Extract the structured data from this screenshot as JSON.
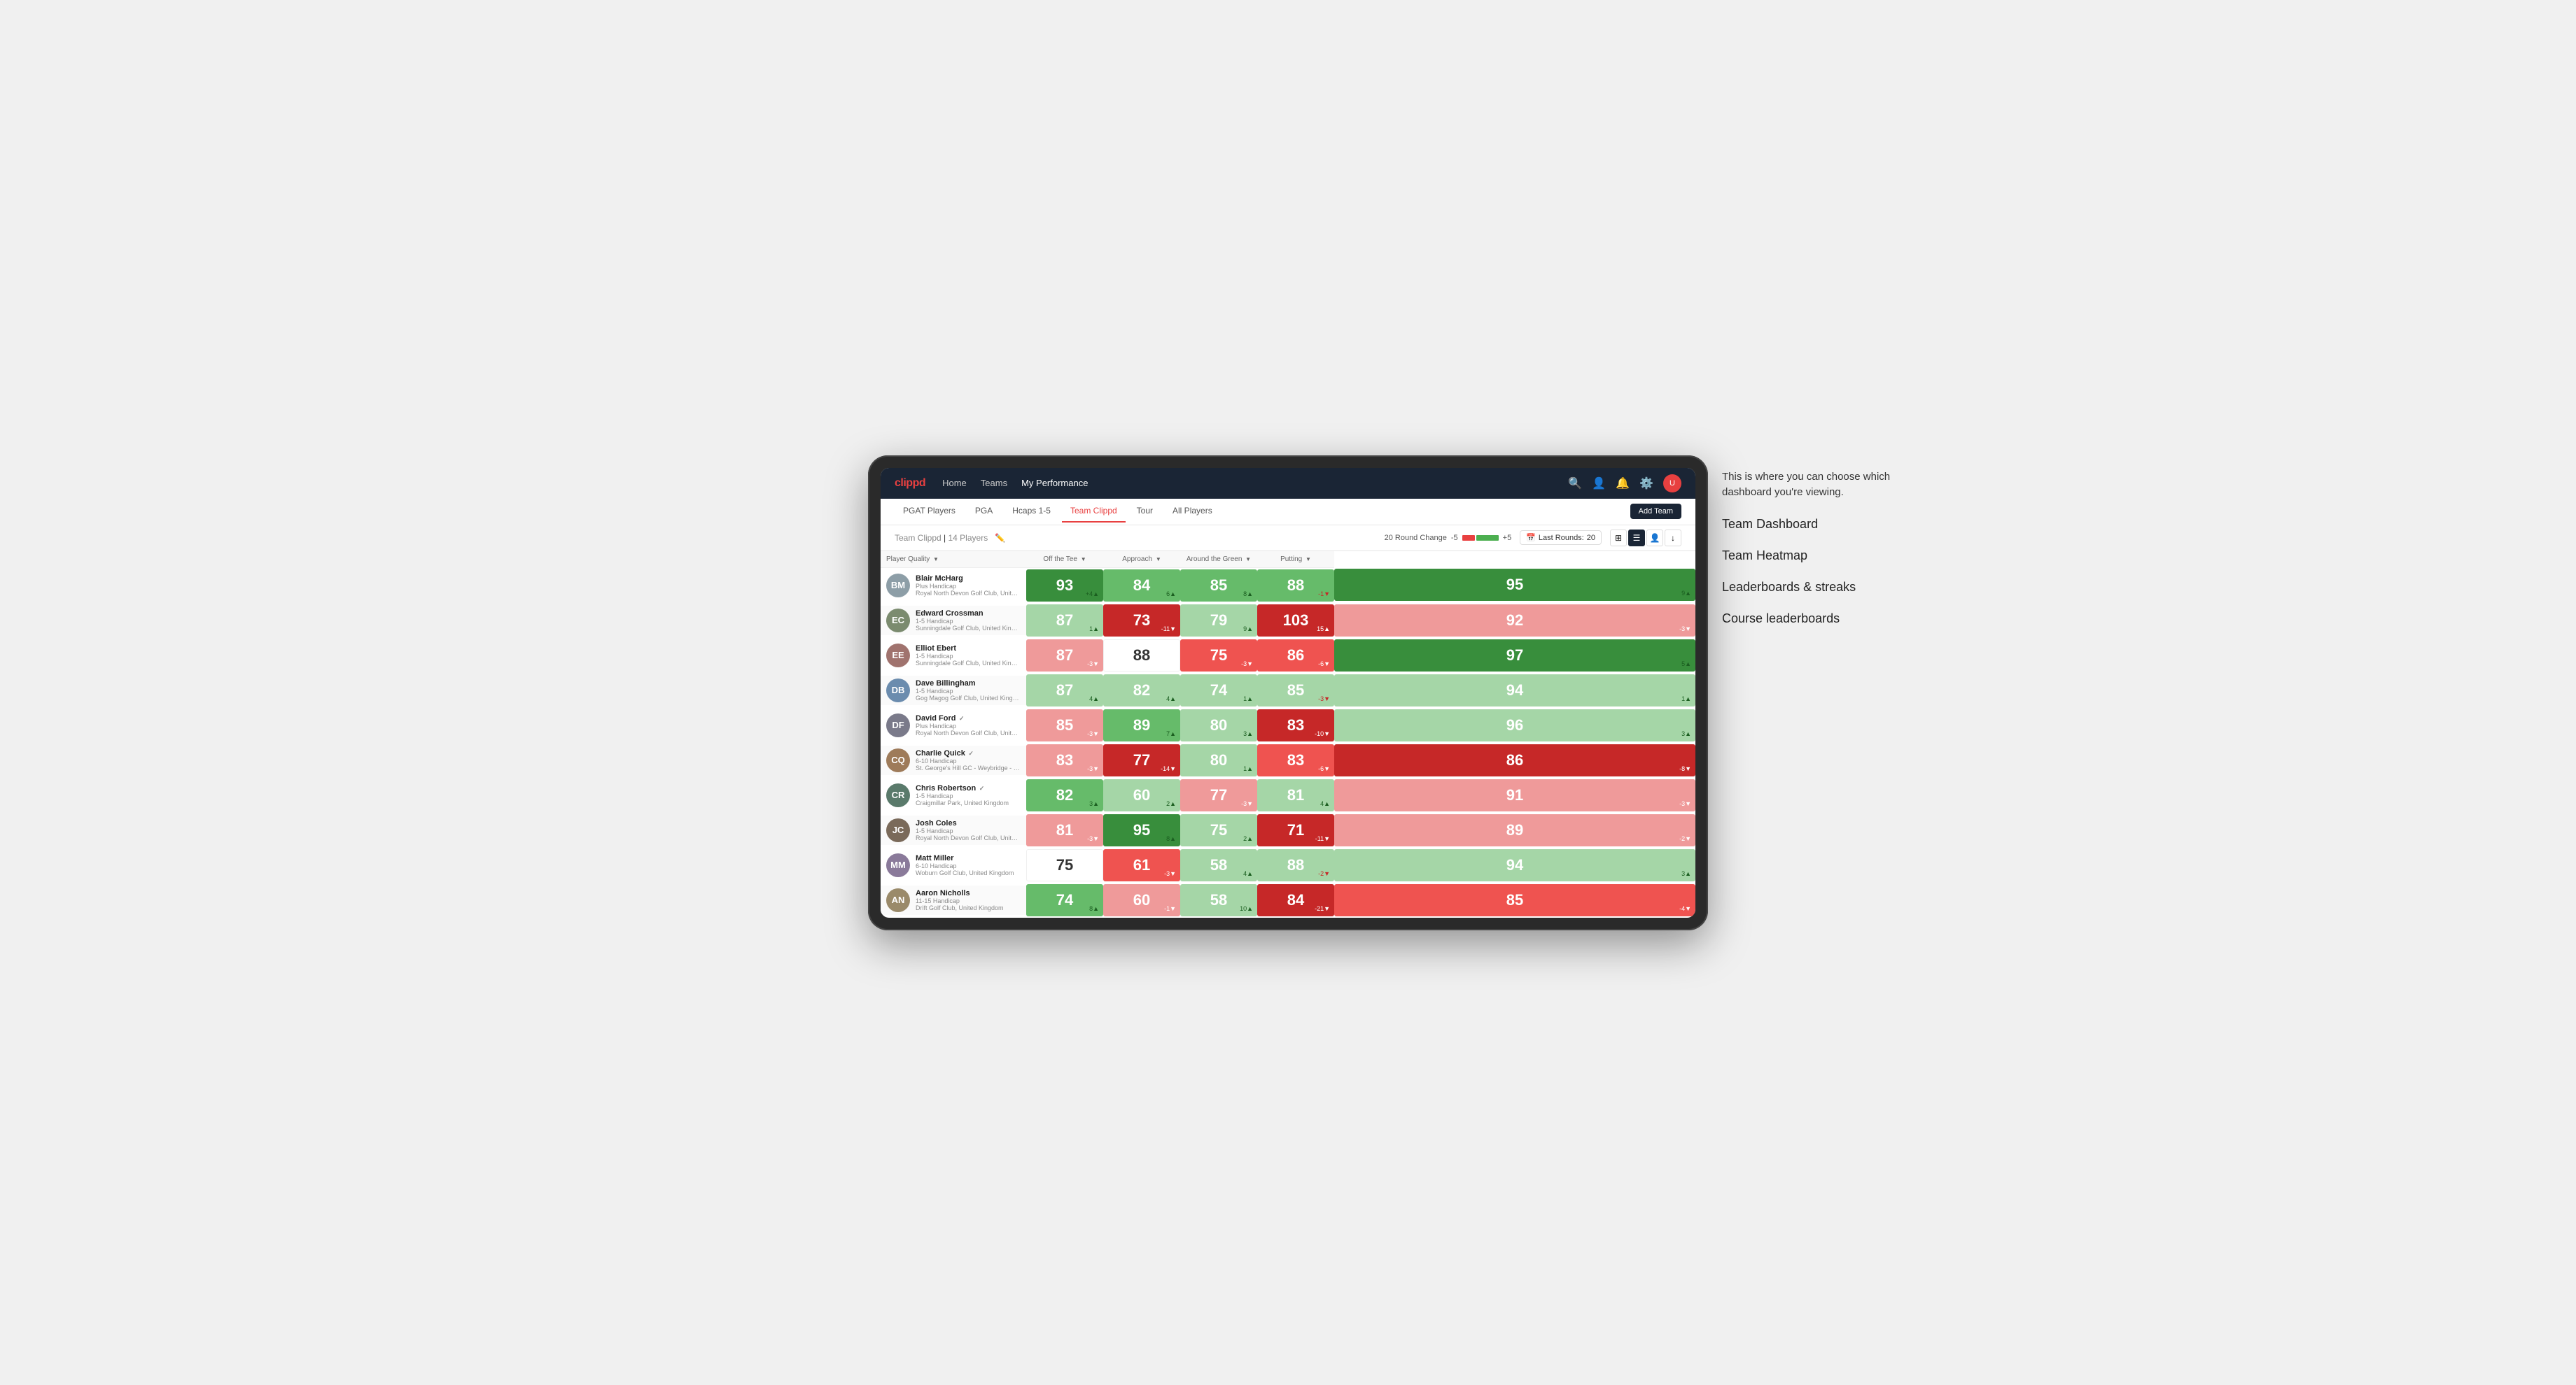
{
  "annotation": {
    "callout": "This is where you can choose which dashboard you're viewing.",
    "items": [
      "Team Dashboard",
      "Team Heatmap",
      "Leaderboards & streaks",
      "Course leaderboards"
    ]
  },
  "nav": {
    "logo": "clippd",
    "links": [
      "Home",
      "Teams",
      "My Performance"
    ],
    "active_link": "My Performance",
    "icons": [
      "search",
      "person",
      "bell",
      "settings",
      "avatar"
    ],
    "avatar_text": "U"
  },
  "tabs": {
    "items": [
      "PGAT Players",
      "PGA",
      "Hcaps 1-5",
      "Team Clippd",
      "Tour",
      "All Players"
    ],
    "active": "Team Clippd",
    "add_button": "Add Team"
  },
  "sub_header": {
    "team_name": "Team Clippd",
    "player_count": "14 Players",
    "round_change_label": "20 Round Change",
    "change_neg": "-5",
    "change_pos": "+5",
    "last_rounds_label": "Last Rounds:",
    "last_rounds_value": "20"
  },
  "table": {
    "columns": [
      {
        "label": "Player Quality",
        "key": "quality"
      },
      {
        "label": "Off the Tee",
        "key": "tee"
      },
      {
        "label": "Approach",
        "key": "approach"
      },
      {
        "label": "Around the Green",
        "key": "green"
      },
      {
        "label": "Putting",
        "key": "putting"
      }
    ],
    "players": [
      {
        "name": "Blair McHarg",
        "handicap": "Plus Handicap",
        "club": "Royal North Devon Golf Club, United Kingdom",
        "initials": "BM",
        "avatar_color": "#8d9ea7",
        "scores": [
          {
            "value": 93,
            "change": "+4",
            "dir": "up",
            "color": "green-dark"
          },
          {
            "value": 84,
            "change": "6",
            "dir": "up",
            "color": "green-med"
          },
          {
            "value": 85,
            "change": "8",
            "dir": "up",
            "color": "green-med"
          },
          {
            "value": 88,
            "change": "-1",
            "dir": "down",
            "color": "green-med"
          },
          {
            "value": 95,
            "change": "9",
            "dir": "up",
            "color": "green-dark"
          }
        ]
      },
      {
        "name": "Edward Crossman",
        "handicap": "1-5 Handicap",
        "club": "Sunningdale Golf Club, United Kingdom",
        "initials": "EC",
        "avatar_color": "#7b8b6f",
        "scores": [
          {
            "value": 87,
            "change": "1",
            "dir": "up",
            "color": "green-light"
          },
          {
            "value": 73,
            "change": "-11",
            "dir": "down",
            "color": "red-dark"
          },
          {
            "value": 79,
            "change": "9",
            "dir": "up",
            "color": "green-light"
          },
          {
            "value": 103,
            "change": "15",
            "dir": "up",
            "color": "red-dark"
          },
          {
            "value": 92,
            "change": "-3",
            "dir": "down",
            "color": "red-light"
          }
        ]
      },
      {
        "name": "Elliot Ebert",
        "handicap": "1-5 Handicap",
        "club": "Sunningdale Golf Club, United Kingdom",
        "initials": "EE",
        "avatar_color": "#a0736e",
        "scores": [
          {
            "value": 87,
            "change": "-3",
            "dir": "down",
            "color": "red-light"
          },
          {
            "value": 88,
            "change": "",
            "dir": "",
            "color": "neutral"
          },
          {
            "value": 75,
            "change": "-3",
            "dir": "down",
            "color": "red-med"
          },
          {
            "value": 86,
            "change": "-6",
            "dir": "down",
            "color": "red-med"
          },
          {
            "value": 97,
            "change": "5",
            "dir": "up",
            "color": "green-dark"
          }
        ]
      },
      {
        "name": "Dave Billingham",
        "handicap": "1-5 Handicap",
        "club": "Gog Magog Golf Club, United Kingdom",
        "initials": "DB",
        "avatar_color": "#6b8cae",
        "scores": [
          {
            "value": 87,
            "change": "4",
            "dir": "up",
            "color": "green-light"
          },
          {
            "value": 82,
            "change": "4",
            "dir": "up",
            "color": "green-light"
          },
          {
            "value": 74,
            "change": "1",
            "dir": "up",
            "color": "green-light"
          },
          {
            "value": 85,
            "change": "-3",
            "dir": "down",
            "color": "green-light"
          },
          {
            "value": 94,
            "change": "1",
            "dir": "up",
            "color": "green-light"
          }
        ]
      },
      {
        "name": "David Ford",
        "handicap": "Plus Handicap",
        "club": "Royal North Devon Golf Club, United Kingdom",
        "initials": "DF",
        "verified": true,
        "avatar_color": "#7a7a8a",
        "scores": [
          {
            "value": 85,
            "change": "-3",
            "dir": "down",
            "color": "red-light"
          },
          {
            "value": 89,
            "change": "7",
            "dir": "up",
            "color": "green-med"
          },
          {
            "value": 80,
            "change": "3",
            "dir": "up",
            "color": "green-light"
          },
          {
            "value": 83,
            "change": "-10",
            "dir": "down",
            "color": "red-dark"
          },
          {
            "value": 96,
            "change": "3",
            "dir": "up",
            "color": "green-light"
          }
        ]
      },
      {
        "name": "Charlie Quick",
        "handicap": "6-10 Handicap",
        "club": "St. George's Hill GC - Weybridge - Surrey, Uni...",
        "initials": "CQ",
        "verified": true,
        "avatar_color": "#9e7b5a",
        "scores": [
          {
            "value": 83,
            "change": "-3",
            "dir": "down",
            "color": "red-light"
          },
          {
            "value": 77,
            "change": "-14",
            "dir": "down",
            "color": "red-dark"
          },
          {
            "value": 80,
            "change": "1",
            "dir": "up",
            "color": "green-light"
          },
          {
            "value": 83,
            "change": "-6",
            "dir": "down",
            "color": "red-med"
          },
          {
            "value": 86,
            "change": "-8",
            "dir": "down",
            "color": "red-dark"
          }
        ]
      },
      {
        "name": "Chris Robertson",
        "handicap": "1-5 Handicap",
        "club": "Craigmillar Park, United Kingdom",
        "initials": "CR",
        "verified": true,
        "avatar_color": "#5a7a6b",
        "scores": [
          {
            "value": 82,
            "change": "3",
            "dir": "up",
            "color": "green-med"
          },
          {
            "value": 60,
            "change": "2",
            "dir": "up",
            "color": "green-light"
          },
          {
            "value": 77,
            "change": "-3",
            "dir": "down",
            "color": "red-light"
          },
          {
            "value": 81,
            "change": "4",
            "dir": "up",
            "color": "green-light"
          },
          {
            "value": 91,
            "change": "-3",
            "dir": "down",
            "color": "red-light"
          }
        ]
      },
      {
        "name": "Josh Coles",
        "handicap": "1-5 Handicap",
        "club": "Royal North Devon Golf Club, United Kingdom",
        "initials": "JC",
        "avatar_color": "#7a6a5a",
        "scores": [
          {
            "value": 81,
            "change": "-3",
            "dir": "down",
            "color": "red-light"
          },
          {
            "value": 95,
            "change": "8",
            "dir": "up",
            "color": "green-dark"
          },
          {
            "value": 75,
            "change": "2",
            "dir": "up",
            "color": "green-light"
          },
          {
            "value": 71,
            "change": "-11",
            "dir": "down",
            "color": "red-dark"
          },
          {
            "value": 89,
            "change": "-2",
            "dir": "down",
            "color": "red-light"
          }
        ]
      },
      {
        "name": "Matt Miller",
        "handicap": "6-10 Handicap",
        "club": "Woburn Golf Club, United Kingdom",
        "initials": "MM",
        "avatar_color": "#8a7a9a",
        "scores": [
          {
            "value": 75,
            "change": "",
            "dir": "",
            "color": "neutral"
          },
          {
            "value": 61,
            "change": "-3",
            "dir": "down",
            "color": "red-med"
          },
          {
            "value": 58,
            "change": "4",
            "dir": "up",
            "color": "green-light"
          },
          {
            "value": 88,
            "change": "-2",
            "dir": "down",
            "color": "green-light"
          },
          {
            "value": 94,
            "change": "3",
            "dir": "up",
            "color": "green-light"
          }
        ]
      },
      {
        "name": "Aaron Nicholls",
        "handicap": "11-15 Handicap",
        "club": "Drift Golf Club, United Kingdom",
        "initials": "AN",
        "avatar_color": "#9a8a6a",
        "scores": [
          {
            "value": 74,
            "change": "8",
            "dir": "up",
            "color": "green-med"
          },
          {
            "value": 60,
            "change": "-1",
            "dir": "down",
            "color": "red-light"
          },
          {
            "value": 58,
            "change": "10",
            "dir": "up",
            "color": "green-light"
          },
          {
            "value": 84,
            "change": "-21",
            "dir": "down",
            "color": "red-dark"
          },
          {
            "value": 85,
            "change": "-4",
            "dir": "down",
            "color": "red-med"
          }
        ]
      }
    ]
  }
}
